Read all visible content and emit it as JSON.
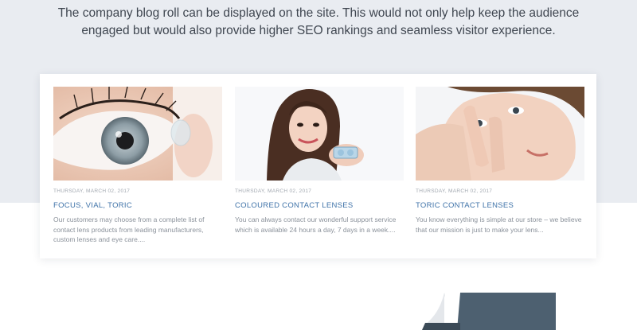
{
  "intro": {
    "text": "The company blog roll can be displayed on the site. This would not only help keep the audience engaged but would also provide higher SEO rankings and seamless visitor experience."
  },
  "posts": [
    {
      "date": "THURSDAY, MARCH 02, 2017",
      "title": "FOCUS, VIAL, TORIC",
      "excerpt": "Our customers may choose from a complete list of contact lens products from leading manufacturers, custom lenses and eye care....",
      "image": "eye-closeup-with-lens"
    },
    {
      "date": "THURSDAY, MARCH 02, 2017",
      "title": "COLOURED CONTACT LENSES",
      "excerpt": "You can always contact our wonderful support service which is available 24 hours a day, 7 days in a week....",
      "image": "woman-holding-lens-case"
    },
    {
      "date": "THURSDAY, MARCH 02, 2017",
      "title": "TORIC CONTACT LENSES",
      "excerpt": "You know everything is simple at our store – we believe that our mission is just to make your lens...",
      "image": "woman-inserting-lens"
    }
  ],
  "colors": {
    "band": "#e9ecf1",
    "title_link": "#3e72a8",
    "deco": "#4d6070"
  }
}
